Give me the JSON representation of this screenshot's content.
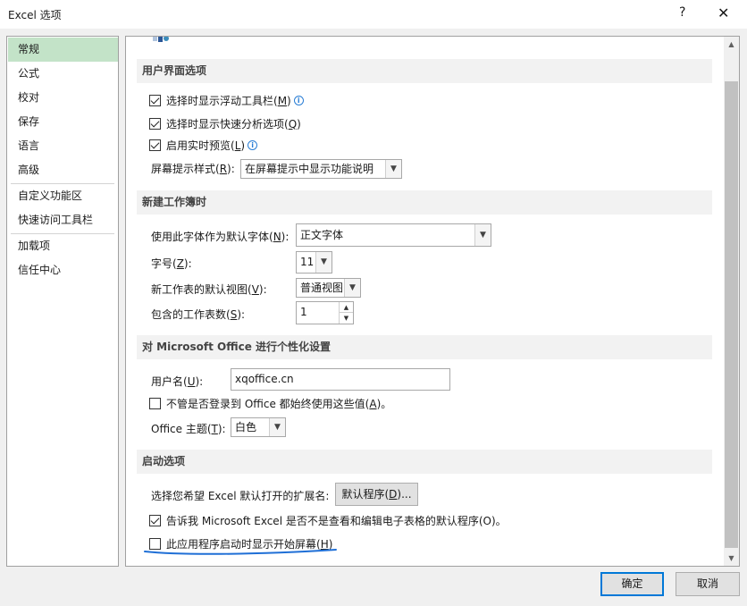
{
  "window": {
    "title": "Excel 选项",
    "help": "?",
    "close": "✕"
  },
  "sidebar": {
    "items": [
      {
        "label": "常规"
      },
      {
        "label": "公式"
      },
      {
        "label": "校对"
      },
      {
        "label": "保存"
      },
      {
        "label": "语言"
      },
      {
        "label": "高级"
      },
      {
        "label": "自定义功能区"
      },
      {
        "label": "快速访问工具栏"
      },
      {
        "label": "加载项"
      },
      {
        "label": "信任中心"
      }
    ],
    "selected": "常规",
    "accent_color": "#c3e3c8"
  },
  "ui_section": {
    "header": "用户界面选项",
    "opt1_pre": "选择时显示浮动工具栏(",
    "opt1_key": "M",
    "opt1_post": ")",
    "opt1_checked": true,
    "opt2_pre": "选择时显示快速分析选项(",
    "opt2_key": "Q",
    "opt2_post": ")",
    "opt2_checked": true,
    "opt3_pre": "启用实时预览(",
    "opt3_key": "L",
    "opt3_post": ")",
    "opt3_checked": true,
    "tip_pre": "屏幕提示样式(",
    "tip_key": "R",
    "tip_post": "):",
    "tip_value": "在屏幕提示中显示功能说明"
  },
  "new_wb_section": {
    "header": "新建工作簿时",
    "font_pre": "使用此字体作为默认字体(",
    "font_key": "N",
    "font_post": "):",
    "font_value": "正文字体",
    "size_pre": "字号(",
    "size_key": "Z",
    "size_post": "):",
    "size_value": "11",
    "view_pre": "新工作表的默认视图(",
    "view_key": "V",
    "view_post": "):",
    "view_value": "普通视图",
    "sheets_pre": "包含的工作表数(",
    "sheets_key": "S",
    "sheets_post": "):",
    "sheets_value": "1"
  },
  "personal_section": {
    "header": "对 Microsoft Office 进行个性化设置",
    "user_pre": "用户名(",
    "user_key": "U",
    "user_post": "):",
    "user_value": "xqoffice.cn",
    "always_pre": "不管是否登录到 Office 都始终使用这些值(",
    "always_key": "A",
    "always_post": ")。",
    "always_checked": false,
    "theme_pre": "Office 主题(",
    "theme_key": "T",
    "theme_post": "):",
    "theme_value": "白色"
  },
  "startup_section": {
    "header": "启动选项",
    "ext_label": "选择您希望 Excel 默认打开的扩展名:",
    "ext_btn_pre": "默认程序(",
    "ext_btn_key": "D",
    "ext_btn_post": ")...",
    "tell_label": "告诉我 Microsoft Excel 是否不是查看和编辑电子表格的默认程序(O)。",
    "tell_checked": true,
    "start_pre": "此应用程序启动时显示开始屏幕(",
    "start_key": "H",
    "start_post": ")",
    "start_checked": false
  },
  "footer": {
    "ok": "确定",
    "cancel": "取消"
  },
  "colors": {
    "primary_border": "#0078d7",
    "annotation": "#1f6fd6"
  }
}
